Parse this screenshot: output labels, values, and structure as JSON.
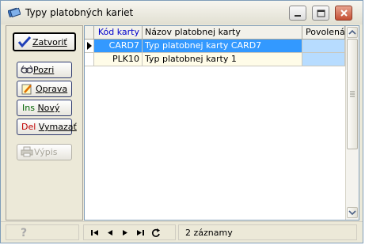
{
  "window": {
    "title": "Typy platobných kariet"
  },
  "toolbar": {
    "zatvorit": "Zatvoriť",
    "pozri": "Pozri",
    "oprava": "Oprava",
    "novy_prefix": "Ins",
    "novy": "Nový",
    "vymazat_prefix": "Del",
    "vymazat": "Vymazať",
    "vypis": "Výpis"
  },
  "grid": {
    "columns": [
      "Kód karty",
      "Názov platobnej karty",
      "Povolená"
    ],
    "rows": [
      {
        "kod": "CARD7",
        "nazov": "Typ platobnej karty CARD7",
        "selected": true
      },
      {
        "kod": "PLK10",
        "nazov": "Typ platobnej karty 1",
        "selected": false
      }
    ]
  },
  "status": {
    "count": "2 záznamy"
  },
  "colors": {
    "selection": "#3399ff",
    "row_alt": "#fffce8",
    "povolena_cell": "#b7dcff",
    "header_blue_text": "#0000cc"
  },
  "icons": [
    "app-icon",
    "minimize-icon",
    "maximize-icon",
    "close-icon",
    "checkmark-icon",
    "glasses-icon",
    "edit-pencil-icon",
    "printer-icon",
    "help-icon",
    "first-record-icon",
    "prev-record-icon",
    "next-record-icon",
    "last-record-icon",
    "refresh-icon",
    "row-pointer-icon"
  ]
}
